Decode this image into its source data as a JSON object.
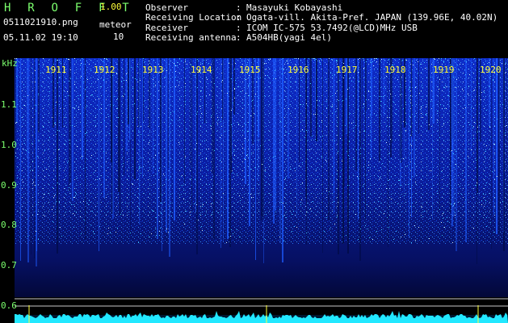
{
  "header": {
    "brand": "H R O F F T",
    "version": "1.00",
    "filename": "0511021910.png",
    "datetime": "05.11.02 19:10",
    "meteor_label": "meteor",
    "meteor_count": "10"
  },
  "info": [
    {
      "label": "Observer",
      "value": "Masayuki Kobayashi"
    },
    {
      "label": "Receiving Location",
      "value": "Ogata-vill. Akita-Pref. JAPAN (139.96E, 40.02N)"
    },
    {
      "label": "Receiver",
      "value": "ICOM IC-575 53.7492(@LCD)MHz USB"
    },
    {
      "label": "Receiving antenna",
      "value": "A504HB(yagi 4el)"
    }
  ],
  "spectrogram": {
    "unit_label": "kHz",
    "y_ticks": [
      "1.1",
      "1.0",
      "0.9",
      "0.8",
      "0.7",
      "0.6"
    ],
    "x_ticks": [
      "1911",
      "1912",
      "1913",
      "1914",
      "1915",
      "1916",
      "1917",
      "1918",
      "1919",
      "1920"
    ],
    "colors": {
      "label_green": "#7CFF6E",
      "label_yellow": "#FFFF3A",
      "background_blue": "#0A1A9A",
      "noise_cyan": "#22E8FF"
    }
  }
}
